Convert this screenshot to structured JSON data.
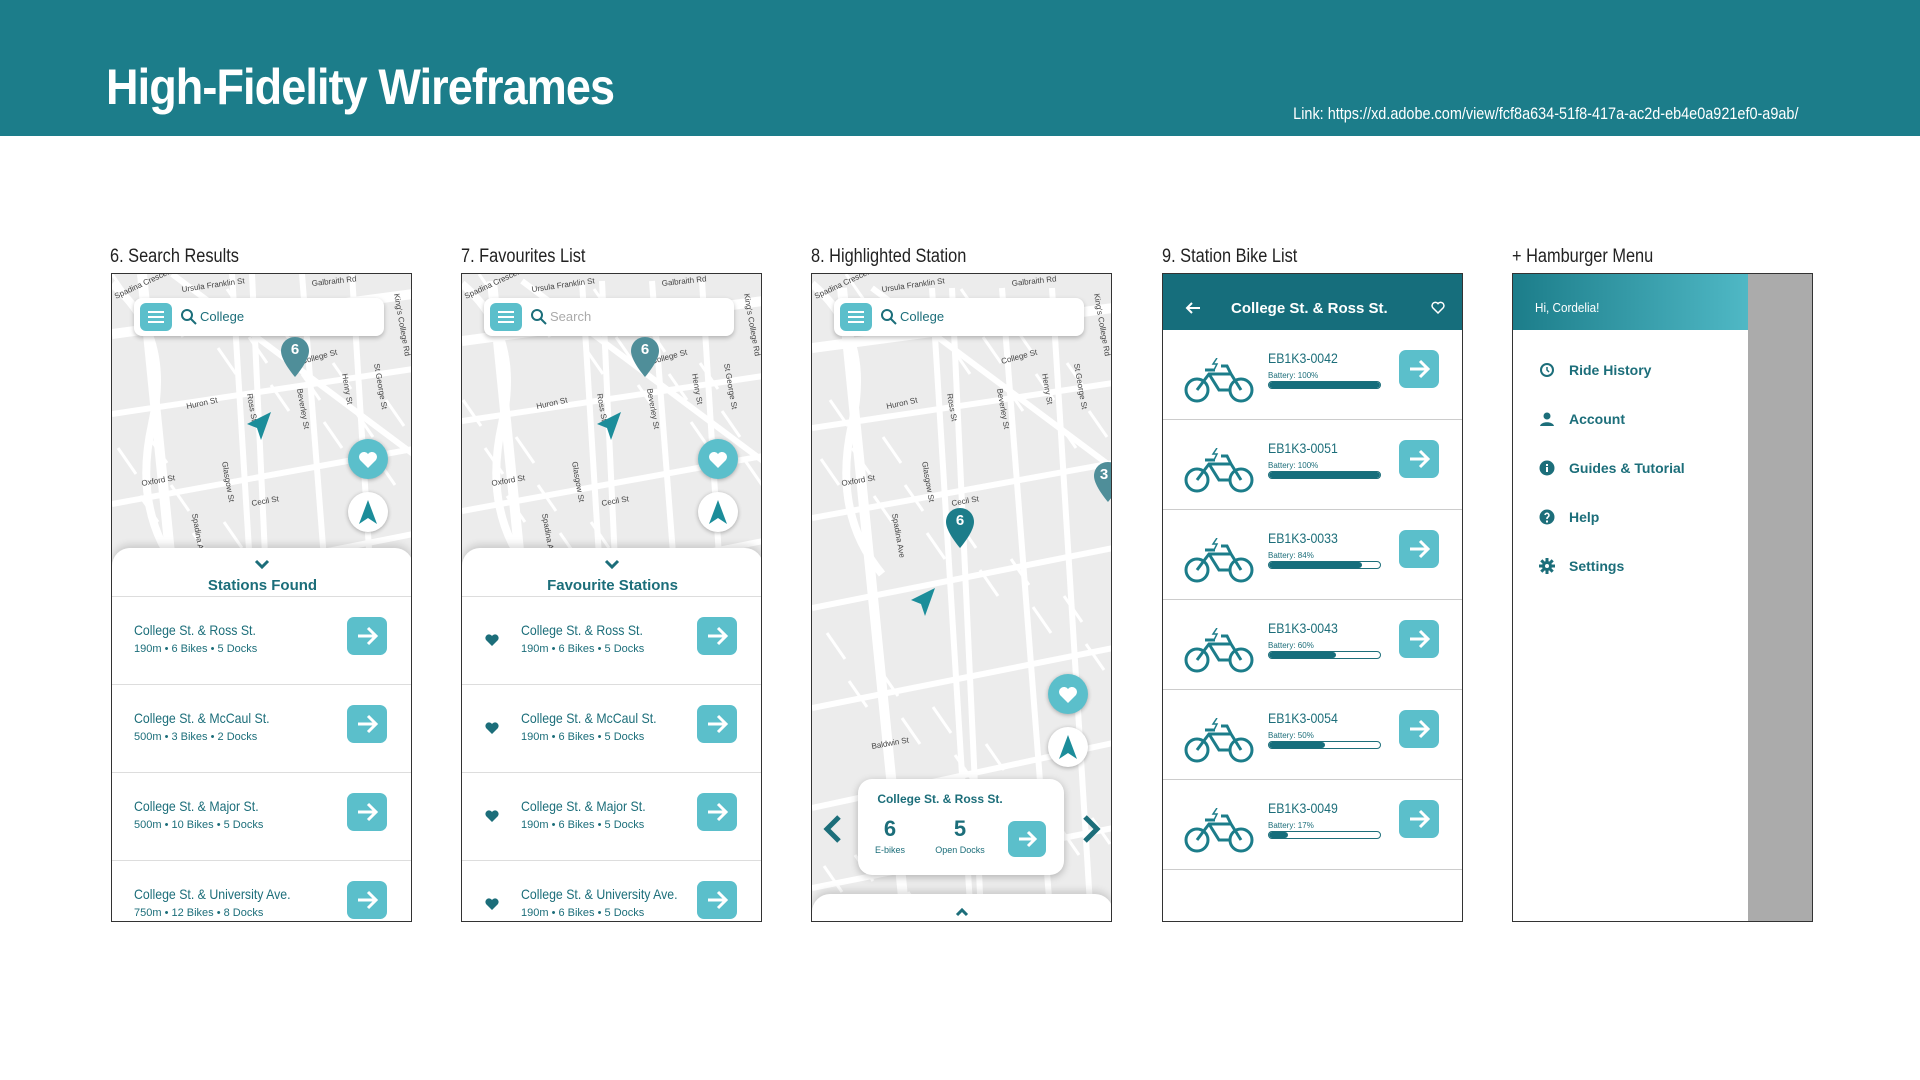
{
  "header": {
    "title": "High-Fidelity Wireframes",
    "link": "Link: https://xd.adobe.com/view/fcf8a634-51f8-417a-ac2d-eb4e0a921ef0-a9ab/"
  },
  "colors": {
    "banner": "#1c7d8a",
    "accent": "#5bbfcb",
    "text": "#1c6e7a"
  },
  "screen6": {
    "caption": "6. Search Results",
    "search_value": "College",
    "pin_label": "6",
    "sheet_title": "Stations Found",
    "results": [
      {
        "name": "College St. & Ross St.",
        "meta": "190m • 6 Bikes • 5 Docks"
      },
      {
        "name": "College St. & McCaul St.",
        "meta": "500m • 3 Bikes • 2 Docks"
      },
      {
        "name": "College St. & Major St.",
        "meta": "500m • 10 Bikes • 5 Docks"
      },
      {
        "name": "College St. & University Ave.",
        "meta": "750m • 12 Bikes • 8 Docks"
      }
    ]
  },
  "screen7": {
    "caption": "7. Favourites List",
    "search_placeholder": "Search",
    "pin_label": "6",
    "sheet_title": "Favourite Stations",
    "favourites": [
      {
        "name": "College St. & Ross St.",
        "meta": "190m • 6 Bikes • 5 Docks"
      },
      {
        "name": "College St. & McCaul St.",
        "meta": "190m • 6 Bikes • 5 Docks"
      },
      {
        "name": "College St. & Major St.",
        "meta": "190m • 6 Bikes • 5 Docks"
      },
      {
        "name": "College St. & University Ave.",
        "meta": "190m • 6 Bikes • 5 Docks"
      }
    ]
  },
  "screen8": {
    "caption": "8. Highlighted Station",
    "search_value": "College",
    "pin_label": "6",
    "edge_pin_label": "3",
    "card": {
      "station": "College St. & Ross St.",
      "ebikes": "6",
      "ebikes_label": "E-bikes",
      "docks": "5",
      "docks_label": "Open Docks"
    }
  },
  "screen9": {
    "caption": "9. Station Bike List",
    "title": "College St. & Ross St.",
    "bikes": [
      {
        "id": "EB1K3-0042",
        "battery_label": "Battery: 100%",
        "battery": 1.0
      },
      {
        "id": "EB1K3-0051",
        "battery_label": "Battery: 100%",
        "battery": 1.0
      },
      {
        "id": "EB1K3-0033",
        "battery_label": "Battery: 84%",
        "battery": 0.84
      },
      {
        "id": "EB1K3-0043",
        "battery_label": "Battery: 60%",
        "battery": 0.6
      },
      {
        "id": "EB1K3-0054",
        "battery_label": "Battery: 50%",
        "battery": 0.5
      },
      {
        "id": "EB1K3-0049",
        "battery_label": "Battery: 17%",
        "battery": 0.17
      }
    ]
  },
  "screen10": {
    "caption": "+ Hamburger Menu",
    "greeting": "Hi, Cordelia!",
    "items": [
      {
        "label": "Ride History",
        "icon": "history-icon"
      },
      {
        "label": "Account",
        "icon": "user-icon"
      },
      {
        "label": "Guides & Tutorial",
        "icon": "info-icon"
      },
      {
        "label": "Help",
        "icon": "help-icon"
      },
      {
        "label": "Settings",
        "icon": "gear-icon"
      }
    ]
  },
  "map_labels": [
    "Spadina Crescent",
    "Ursula Franklin St",
    "Galbraith Rd",
    "King's College Rd",
    "College St",
    "Huron St",
    "Ross St",
    "Beverley St",
    "Henry St",
    "St George St",
    "Glasgow St",
    "Cecil St",
    "Oxford St",
    "Spadina Ave",
    "Baldwin St"
  ]
}
